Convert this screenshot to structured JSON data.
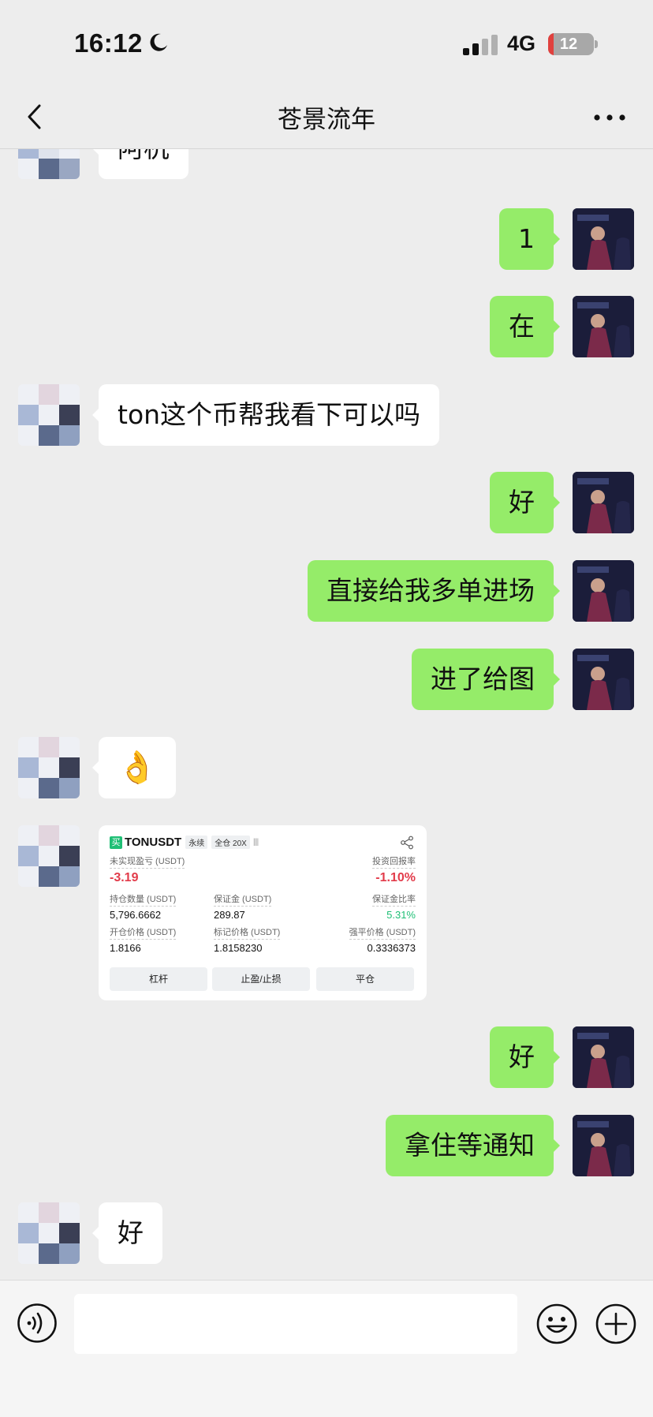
{
  "status_bar": {
    "time": "16:12",
    "network": "4G",
    "battery": "12",
    "battery_level": 0.12
  },
  "header": {
    "title": "苍景流年",
    "back_icon": "chevron-left-icon",
    "more_icon": "more-dots-icon"
  },
  "messages": [
    {
      "side": "in",
      "type": "text",
      "text": "阿杭"
    },
    {
      "side": "out",
      "type": "text",
      "text": "1"
    },
    {
      "side": "out",
      "type": "text",
      "text": "在"
    },
    {
      "side": "in",
      "type": "text",
      "text": "ton这个币帮我看下可以吗"
    },
    {
      "side": "out",
      "type": "text",
      "text": "好"
    },
    {
      "side": "out",
      "type": "text",
      "text": "直接给我多单进场"
    },
    {
      "side": "out",
      "type": "text",
      "text": "进了给图"
    },
    {
      "side": "in",
      "type": "emoji",
      "text": "👌"
    },
    {
      "side": "in",
      "type": "image",
      "card": {
        "buy_tag": "买",
        "symbol": "TONUSDT",
        "tag_perpetual": "永续",
        "tag_margin": "全仓 20X",
        "signal_bars": "||||",
        "unrealized_pnl_label": "未实现盈亏 (USDT)",
        "unrealized_pnl": "-3.19",
        "roi_label": "投资回报率",
        "roi": "-1.10%",
        "position_size_label": "持仓数量 (USDT)",
        "position_size": "5,796.6662",
        "margin_label": "保证金 (USDT)",
        "margin": "289.87",
        "margin_ratio_label": "保证金比率",
        "margin_ratio": "5.31%",
        "entry_price_label": "开仓价格 (USDT)",
        "entry_price": "1.8166",
        "mark_price_label": "标记价格 (USDT)",
        "mark_price": "1.8158230",
        "liq_price_label": "强平价格 (USDT)",
        "liq_price": "0.3336373",
        "btn_leverage": "杠杆",
        "btn_tpsl": "止盈/止损",
        "btn_close": "平仓"
      }
    },
    {
      "side": "out",
      "type": "text",
      "text": "好"
    },
    {
      "side": "out",
      "type": "text",
      "text": "拿住等通知"
    },
    {
      "side": "in",
      "type": "text",
      "text": "好"
    }
  ],
  "input_bar": {
    "voice_icon": "voice-icon",
    "placeholder": "",
    "emoji_icon": "emoji-icon",
    "plus_icon": "plus-icon"
  },
  "colors": {
    "background": "#ededed",
    "outgoing_bubble": "#95ec69",
    "incoming_bubble": "#ffffff",
    "loss_red": "#e23b4a",
    "gain_green": "#1fbf75"
  }
}
